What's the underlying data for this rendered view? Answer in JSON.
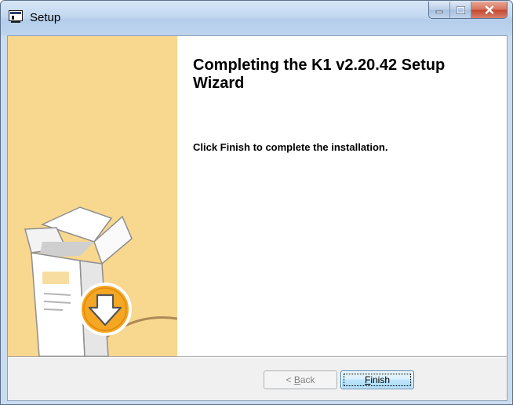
{
  "window": {
    "title": "Setup"
  },
  "sidebar": {
    "image": "installer-box-with-download-arrow"
  },
  "content": {
    "heading": "Completing the K1 v2.20.42 Setup Wizard",
    "description": "Click Finish to complete the installation."
  },
  "buttons": {
    "back": {
      "prefix": "< ",
      "mnemonic": "B",
      "rest": "ack",
      "enabled": false
    },
    "finish": {
      "prefix": "",
      "mnemonic": "F",
      "rest": "inish",
      "enabled": true
    }
  },
  "colors": {
    "sidebar_bg": "#f8d78f",
    "accent_orange": "#f5a623",
    "button_border": "#3c7fb1"
  }
}
